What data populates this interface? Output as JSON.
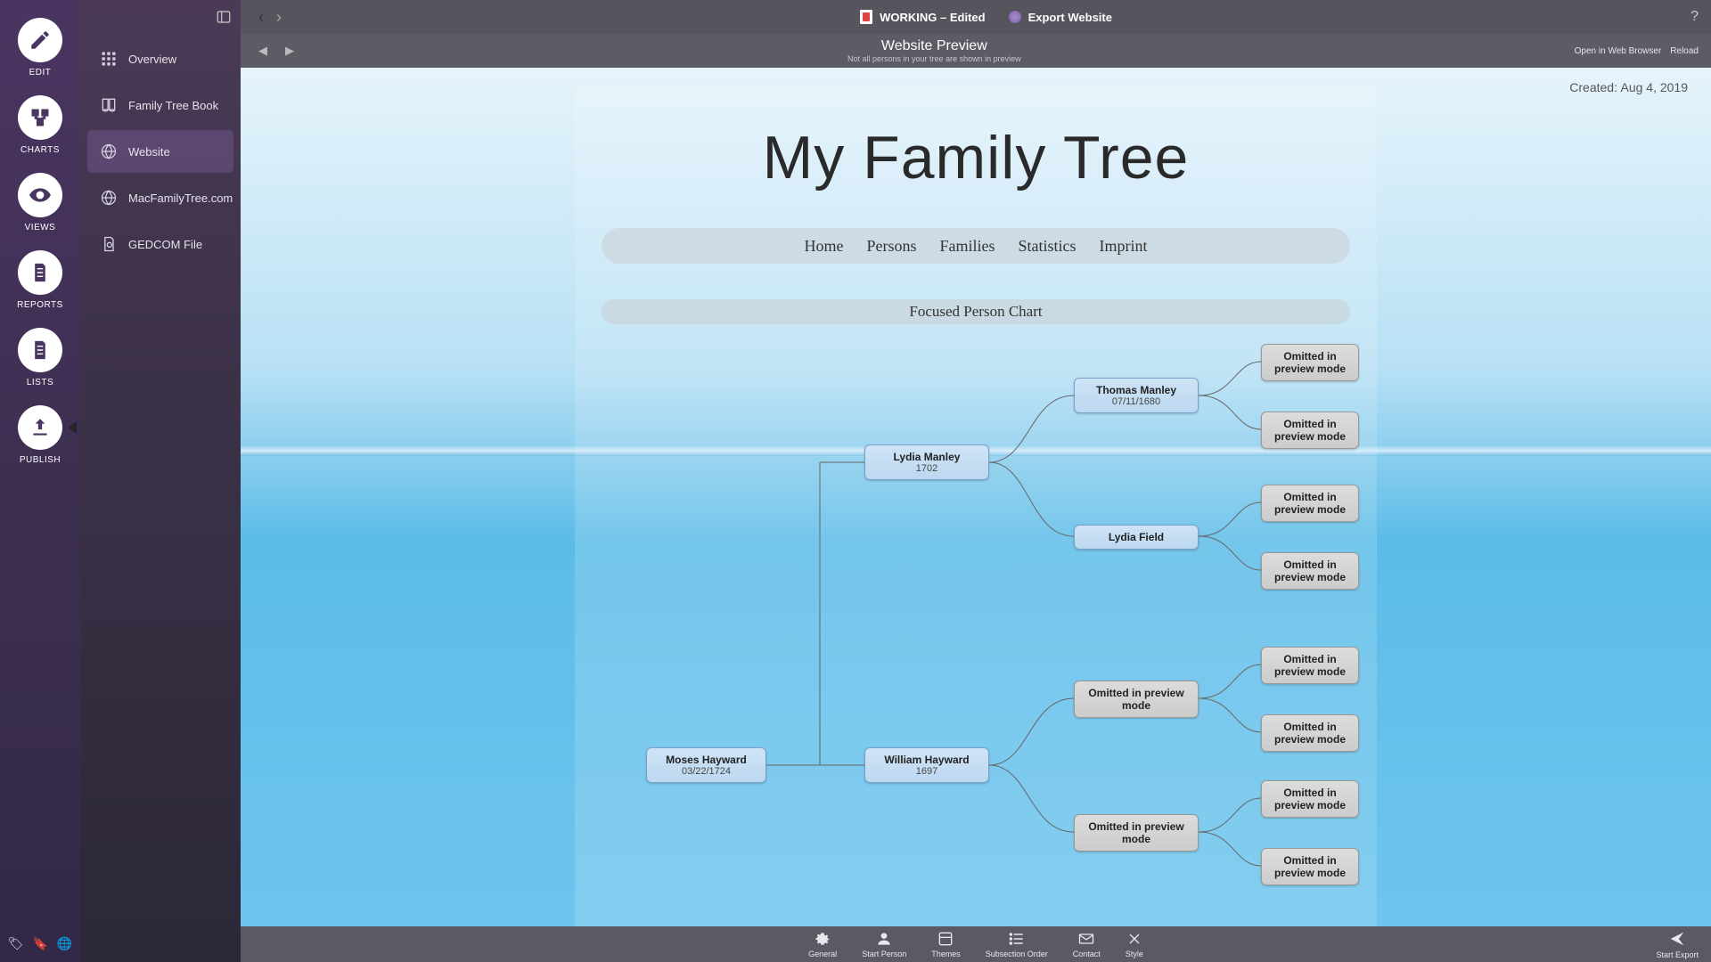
{
  "rail": [
    {
      "key": "edit",
      "label": "EDIT"
    },
    {
      "key": "charts",
      "label": "CHARTS"
    },
    {
      "key": "views",
      "label": "VIEWS"
    },
    {
      "key": "reports",
      "label": "REPORTS"
    },
    {
      "key": "lists",
      "label": "LISTS"
    },
    {
      "key": "publish",
      "label": "PUBLISH"
    }
  ],
  "panel": {
    "items": [
      {
        "label": "Overview"
      },
      {
        "label": "Family Tree Book"
      },
      {
        "label": "Website"
      },
      {
        "label": "MacFamilyTree.com"
      },
      {
        "label": "GEDCOM File"
      }
    ]
  },
  "topbar": {
    "doc": "WORKING – Edited",
    "export": "Export Website"
  },
  "preview": {
    "title": "Website Preview",
    "sub": "Not all persons in your tree are shown in preview",
    "open": "Open in Web Browser",
    "reload": "Reload"
  },
  "page": {
    "created_label": "Created:",
    "created_date": "Aug 4, 2019",
    "title": "My Family Tree",
    "nav": [
      "Home",
      "Persons",
      "Families",
      "Statistics",
      "Imprint"
    ],
    "section": "Focused Person Chart"
  },
  "chart": {
    "nodes": {
      "moses": {
        "name": "Moses Hayward",
        "date": "03/22/1724"
      },
      "lydia_m": {
        "name": "Lydia Manley",
        "date": "1702"
      },
      "william": {
        "name": "William Hayward",
        "date": "1697"
      },
      "thomas": {
        "name": "Thomas Manley",
        "date": "07/11/1680"
      },
      "lydia_f": {
        "name": "Lydia Field",
        "date": ""
      },
      "omit": "Omitted in preview mode"
    }
  },
  "toolbar": {
    "items": [
      {
        "label": "General"
      },
      {
        "label": "Start Person"
      },
      {
        "label": "Themes"
      },
      {
        "label": "Subsection Order"
      },
      {
        "label": "Contact"
      },
      {
        "label": "Style"
      }
    ],
    "start_export": "Start Export"
  }
}
